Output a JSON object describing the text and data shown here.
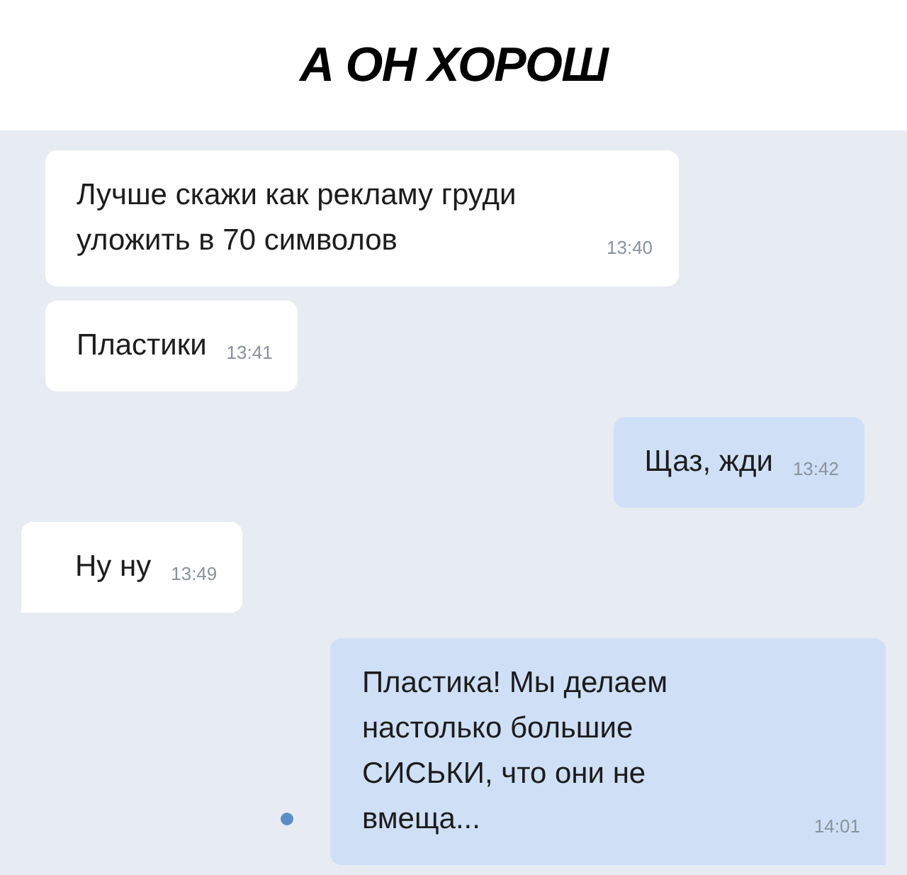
{
  "caption": "А ОН ХОРОШ",
  "messages": [
    {
      "kind": "incoming",
      "text": "Лучше скажи как рекламу груди уложить в 70 символов",
      "time": "13:40",
      "tail": false,
      "unread": false
    },
    {
      "kind": "incoming",
      "text": "Пластики",
      "time": "13:41",
      "tail": false,
      "unread": false
    },
    {
      "kind": "outgoing",
      "text": "Щаз, жди",
      "time": "13:42",
      "tail": false,
      "unread": false
    },
    {
      "kind": "incoming",
      "text": "Ну ну",
      "time": "13:49",
      "tail": true,
      "unread": false
    },
    {
      "kind": "outgoing",
      "text": "Пластика! Мы делаем настолько большие СИСЬКИ, что они не вмеща...",
      "time": "14:01",
      "tail": true,
      "unread": true
    }
  ]
}
